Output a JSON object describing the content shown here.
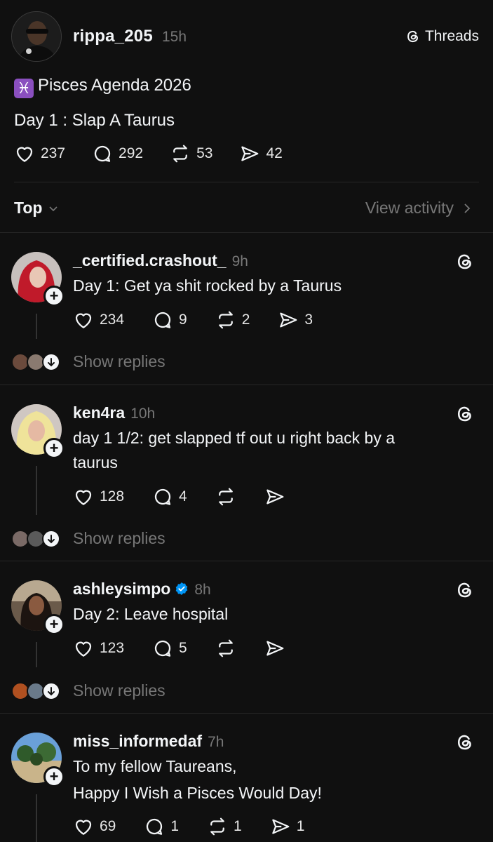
{
  "post": {
    "author": "rippa_205",
    "time": "15h",
    "threads_label": "Threads",
    "badge_glyph": "♓",
    "line1": "Pisces Agenda 2026",
    "line2": "Day 1 : Slap A Taurus",
    "likes": "237",
    "replies": "292",
    "reposts": "53",
    "shares": "42"
  },
  "sort": {
    "label": "Top",
    "view_activity": "View activity"
  },
  "replies": [
    {
      "user": "_certified.crashout_",
      "time": "9h",
      "verified": false,
      "text": "Day 1: Get ya shit rocked by a Taurus",
      "likes": "234",
      "comments": "9",
      "reposts": "2",
      "shares": "3",
      "show_replies": "Show replies"
    },
    {
      "user": "ken4ra",
      "time": "10h",
      "verified": false,
      "text": "day 1 1/2: get slapped tf out u right back by a taurus",
      "likes": "128",
      "comments": "4",
      "reposts": "",
      "shares": "",
      "show_replies": "Show replies"
    },
    {
      "user": "ashleysimpo",
      "time": "8h",
      "verified": true,
      "text": "Day 2: Leave hospital",
      "likes": "123",
      "comments": "5",
      "reposts": "",
      "shares": "",
      "show_replies": "Show replies"
    },
    {
      "user": "miss_informedaf",
      "time": "7h",
      "verified": false,
      "text_line1": "To my fellow Taureans,",
      "text_line2": "Happy I Wish a Pisces Would Day!",
      "likes": "69",
      "comments": "1",
      "reposts": "1",
      "shares": "1"
    }
  ],
  "icons": {
    "like": "heart-icon",
    "comment": "comment-icon",
    "repost": "repost-icon",
    "share": "send-icon",
    "threads": "threads-logo-icon",
    "verified": "verified-badge-icon"
  },
  "colors": {
    "background": "#101010",
    "text": "#f3f5f7",
    "muted": "#777777",
    "verified": "#0095f6"
  }
}
